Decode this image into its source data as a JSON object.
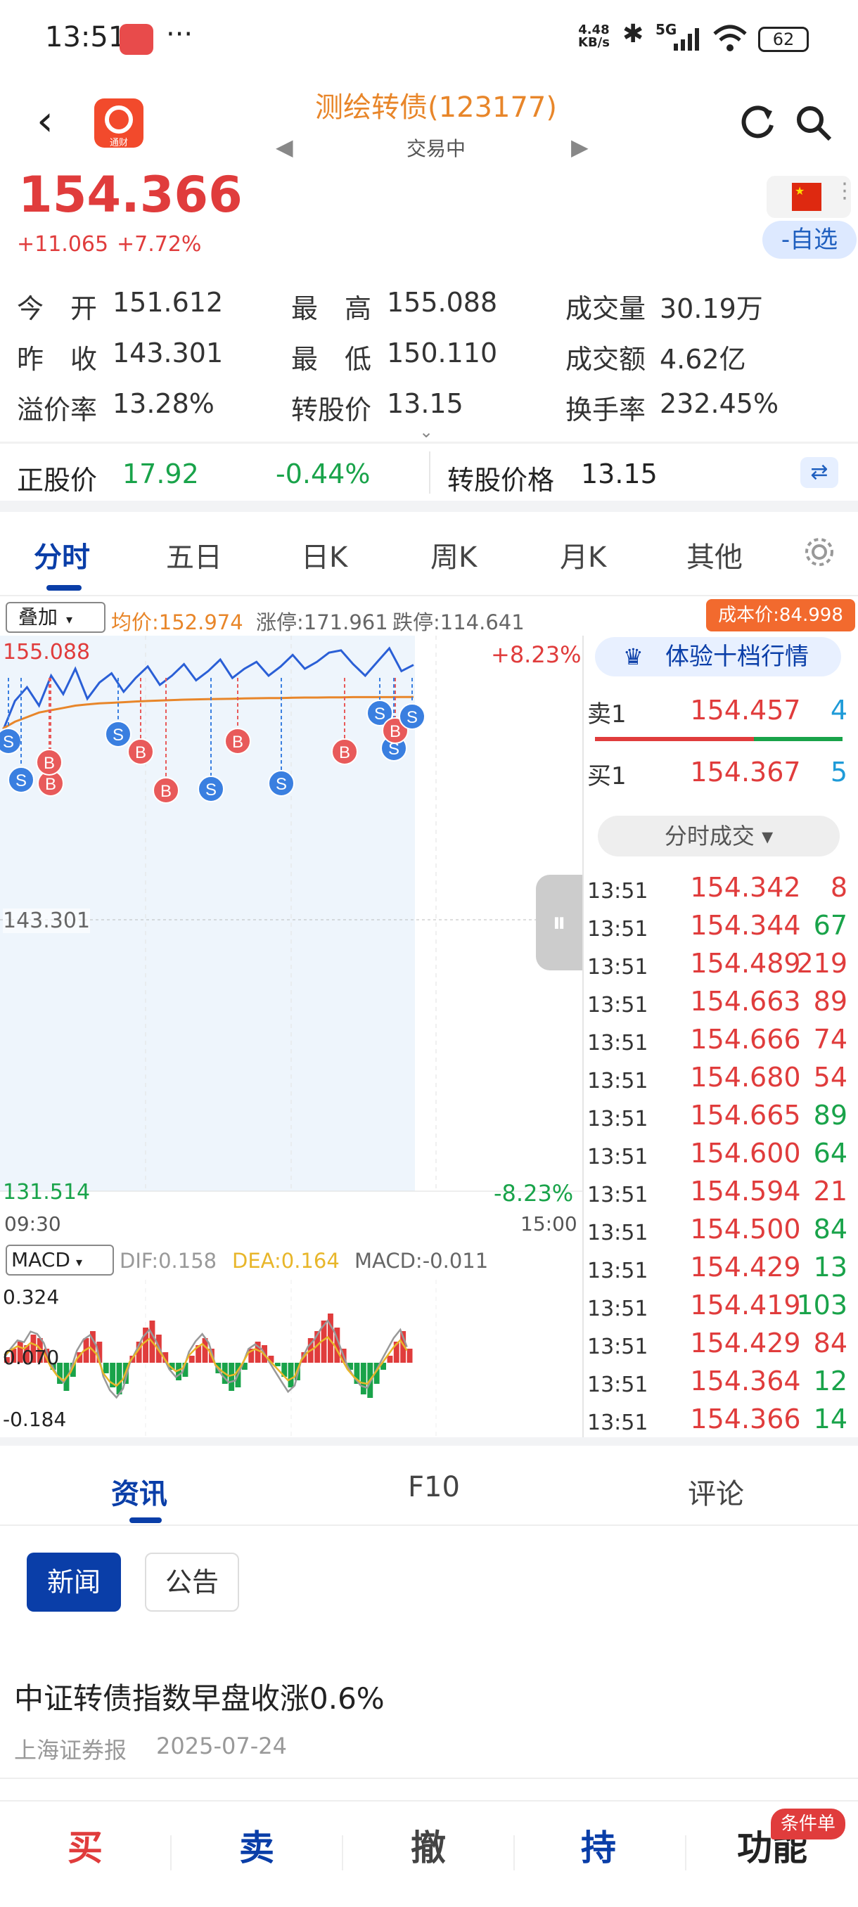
{
  "status": {
    "time": "13:51",
    "net_speed_top": "4.48",
    "net_speed_bottom": "KB/s",
    "signal": "5G",
    "battery": "62",
    "more": "···"
  },
  "header": {
    "title": "测绘转债(123177)",
    "subtitle": "交易中",
    "app_logo_text": "通财"
  },
  "quote": {
    "price": "154.366",
    "change": "+11.065",
    "change_pct": "+7.72%",
    "watch_label": "-自选"
  },
  "stats": [
    {
      "label": "今　开",
      "value": "151.612"
    },
    {
      "label": "最　高",
      "value": "155.088"
    },
    {
      "label": "成交量",
      "value": "30.19万"
    },
    {
      "label": "昨　收",
      "value": "143.301"
    },
    {
      "label": "最　低",
      "value": "150.110"
    },
    {
      "label": "成交额",
      "value": "4.62亿"
    },
    {
      "label": "溢价率",
      "value": "13.28%"
    },
    {
      "label": "转股价",
      "value": "13.15"
    },
    {
      "label": "换手率",
      "value": "232.45%"
    }
  ],
  "stock": {
    "label": "正股价",
    "price": "17.92",
    "pct": "-0.44%",
    "conv_label": "转股价格",
    "conv_value": "13.15"
  },
  "tabs": [
    "分时",
    "五日",
    "日K",
    "周K",
    "月K",
    "其他"
  ],
  "chart_bar": {
    "overlay": "叠加",
    "avg": "均价:152.974",
    "limit_up": "涨停:171.961",
    "limit_down": "跌停:114.641",
    "cost": "成本价:84.998"
  },
  "chart_labels": {
    "high": "155.088",
    "high_pct": "+8.23%",
    "mid": "143.301",
    "low": "131.514",
    "low_pct": "-8.23%",
    "t_start": "09:30",
    "t_end": "15:00"
  },
  "macd": {
    "label": "MACD",
    "dif": "DIF:0.158",
    "dea": "DEA:0.164",
    "macd": "MACD:-0.011",
    "top": "0.324",
    "mid": "0.070",
    "bottom": "-0.184"
  },
  "orderbook": {
    "banner": "体验十档行情",
    "sell_label": "卖1",
    "sell_price": "154.457",
    "sell_vol": "4",
    "buy_label": "买1",
    "buy_price": "154.367",
    "buy_vol": "5",
    "trades_btn": "分时成交"
  },
  "trades": [
    {
      "t": "13:51",
      "p": "154.342",
      "v": "8",
      "c": "red"
    },
    {
      "t": "13:51",
      "p": "154.344",
      "v": "67",
      "c": "green"
    },
    {
      "t": "13:51",
      "p": "154.489",
      "v": "219",
      "c": "red"
    },
    {
      "t": "13:51",
      "p": "154.663",
      "v": "89",
      "c": "red"
    },
    {
      "t": "13:51",
      "p": "154.666",
      "v": "74",
      "c": "red"
    },
    {
      "t": "13:51",
      "p": "154.680",
      "v": "54",
      "c": "red"
    },
    {
      "t": "13:51",
      "p": "154.665",
      "v": "89",
      "c": "green"
    },
    {
      "t": "13:51",
      "p": "154.600",
      "v": "64",
      "c": "green"
    },
    {
      "t": "13:51",
      "p": "154.594",
      "v": "21",
      "c": "red"
    },
    {
      "t": "13:51",
      "p": "154.500",
      "v": "84",
      "c": "green"
    },
    {
      "t": "13:51",
      "p": "154.429",
      "v": "13",
      "c": "green"
    },
    {
      "t": "13:51",
      "p": "154.419",
      "v": "103",
      "c": "green"
    },
    {
      "t": "13:51",
      "p": "154.429",
      "v": "84",
      "c": "red"
    },
    {
      "t": "13:51",
      "p": "154.364",
      "v": "12",
      "c": "green"
    },
    {
      "t": "13:51",
      "p": "154.366",
      "v": "14",
      "c": "green"
    }
  ],
  "info_tabs": [
    "资讯",
    "F10",
    "评论"
  ],
  "news_tabs": [
    "新闻",
    "公告"
  ],
  "news": {
    "title": "中证转债指数早盘收涨0.6%",
    "source": "上海证券报",
    "date": "2025-07-24"
  },
  "bottom_nav": [
    "买",
    "卖",
    "撤",
    "持",
    "功能"
  ],
  "bottom_badge": "条件单",
  "colors": {
    "red": "#e03c3c",
    "green": "#19a34a",
    "blue": "#1f5fbf",
    "orange": "#e8862a",
    "accent": "#0a3ea8"
  },
  "chart_data": {
    "type": "line",
    "title": "",
    "ylim": [
      131.514,
      155.088
    ],
    "yref": 143.301,
    "series": [
      {
        "name": "price",
        "values": [
          151.5,
          152.8,
          153.4,
          152.6,
          153.9,
          153.1,
          154.2,
          152.9,
          153.6,
          154.0,
          153.2,
          153.8,
          154.3,
          153.5,
          153.9,
          154.4,
          153.7,
          154.1,
          154.6,
          153.8,
          154.2,
          154.5,
          153.9,
          154.3,
          154.8,
          154.2,
          154.5,
          154.9,
          155.0,
          154.4,
          153.9,
          154.5,
          155.088,
          154.1,
          154.366
        ]
      },
      {
        "name": "avg",
        "values": [
          151.6,
          151.9,
          152.1,
          152.3,
          152.4,
          152.5,
          152.6,
          152.65,
          152.7,
          152.72,
          152.75,
          152.78,
          152.8,
          152.82,
          152.84,
          152.86,
          152.87,
          152.88,
          152.89,
          152.9,
          152.91,
          152.92,
          152.93,
          152.93,
          152.94,
          152.95,
          152.95,
          152.96,
          152.96,
          152.97,
          152.97,
          152.97,
          152.97,
          152.974,
          152.974
        ]
      }
    ],
    "trade_marks": [
      "S",
      "S",
      "B",
      "B",
      "S",
      "B",
      "B",
      "S",
      "B",
      "S",
      "B",
      "S",
      "S",
      "B",
      "S"
    ]
  }
}
